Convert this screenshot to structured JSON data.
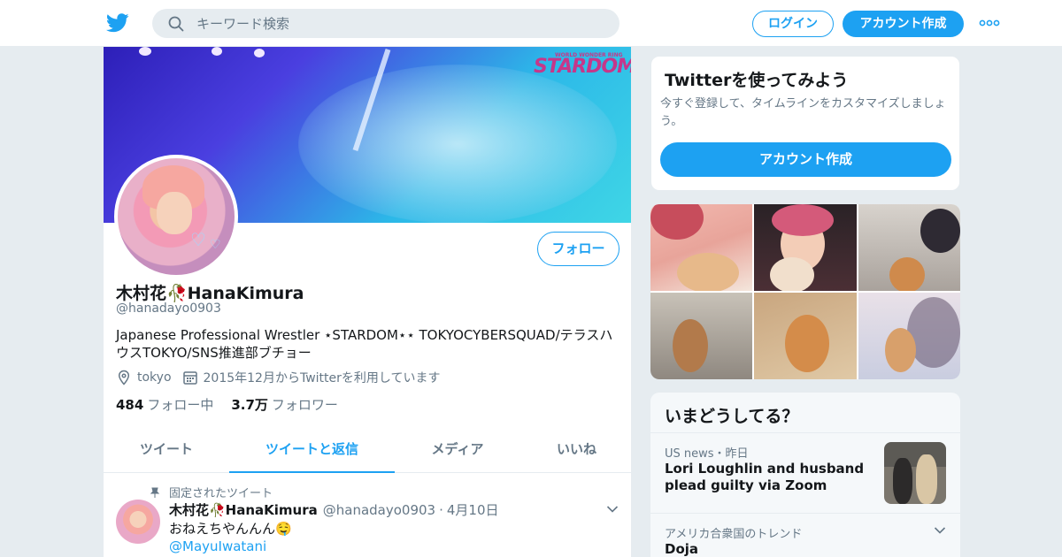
{
  "topbar": {
    "search_placeholder": "キーワード検索",
    "login_label": "ログイン",
    "signup_label": "アカウント作成"
  },
  "profile": {
    "banner_logo": "STARDOM",
    "banner_logo_small": "WORLD WONDER RING",
    "follow_label": "フォロー",
    "name": "木村花🥀HanaKimura",
    "handle": "@hanadayo0903",
    "bio": "Japanese Professional Wrestler ⋆STARDOM⋆⋆ TOKYOCYBERSQUAD/テラスハウスTOKYO/SNS推進部ブチョー",
    "location": "tokyo",
    "joined": "2015年12月からTwitterを利用しています",
    "following_count": "484",
    "following_label": "フォロー中",
    "followers_count": "3.7万",
    "followers_label": "フォロワー"
  },
  "tabs": [
    {
      "label": "ツイート"
    },
    {
      "label": "ツイートと返信"
    },
    {
      "label": "メディア"
    },
    {
      "label": "いいね"
    }
  ],
  "pinned": {
    "label": "固定されたツイート",
    "name": "木村花🥀HanaKimura",
    "handle": "@hanadayo0903",
    "date": "4月10日",
    "text": "おねえちやんんん🤤",
    "mention": "@MayuIwatani"
  },
  "signup_card": {
    "title": "Twitterを使ってみよう",
    "body": "今すぐ登録して、タイムラインをカスタマイズしましょう。",
    "button": "アカウント作成"
  },
  "trends": {
    "title": "いまどうしてる？",
    "items": [
      {
        "category": "US news・昨日",
        "headline": "Lori Loughlin and husband plead guilty via Zoom"
      },
      {
        "category": "アメリカ合衆国のトレンド",
        "headline": "Doja"
      }
    ]
  },
  "colors": {
    "accent": "#1da1f2",
    "text": "#14171a",
    "muted": "#657786",
    "background": "#e6ecf0"
  }
}
